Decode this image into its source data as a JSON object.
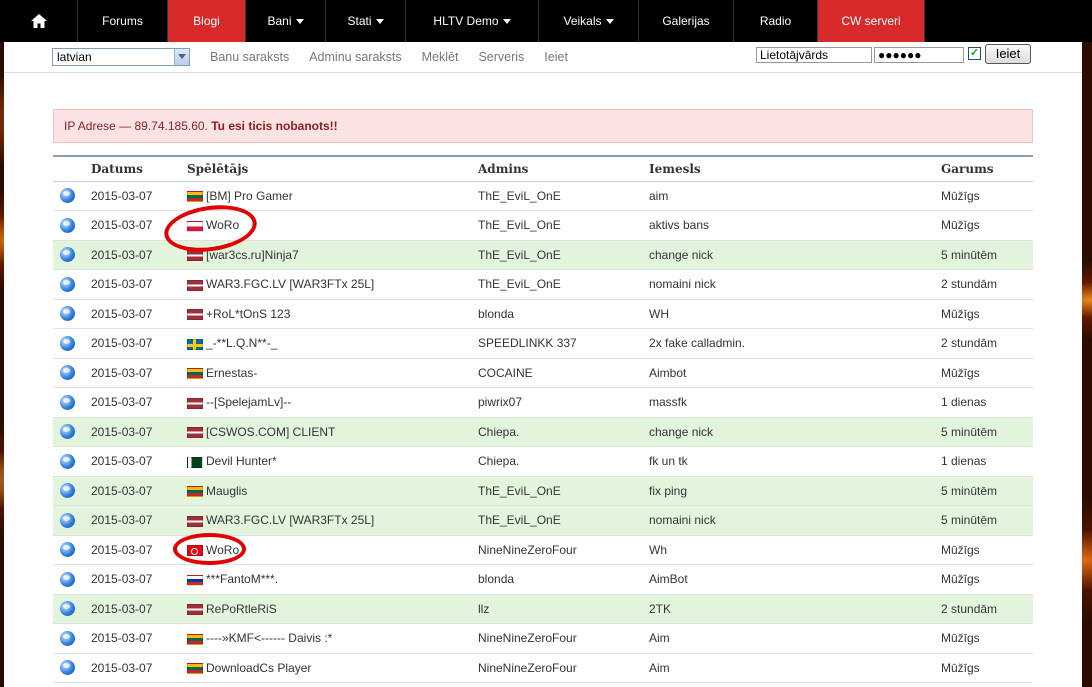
{
  "nav": {
    "items": [
      {
        "label": "Forums",
        "caret": false,
        "active": false
      },
      {
        "label": "Blogi",
        "caret": false,
        "active": true
      },
      {
        "label": "Bani",
        "caret": true,
        "active": false
      },
      {
        "label": "Stati",
        "caret": true,
        "active": false
      },
      {
        "label": "HLTV Demo",
        "caret": true,
        "active": false
      },
      {
        "label": "Veikals",
        "caret": true,
        "active": false
      },
      {
        "label": "Galerijas",
        "caret": false,
        "active": false
      },
      {
        "label": "Radio",
        "caret": false,
        "active": false
      },
      {
        "label": "CW serveri",
        "caret": false,
        "active": true
      }
    ]
  },
  "subbar": {
    "language": "latvian",
    "links": [
      "Banu saraksts",
      "Adminu saraksts",
      "Meklēt",
      "Serveris",
      "Ieiet"
    ],
    "username_value": "Lietotājvārds",
    "password_value": "●●●●●●",
    "login_label": "Ieiet"
  },
  "alert": {
    "prefix": "IP Adrese — 89.74.185.60. ",
    "message": "Tu esi ticis nobanots!!"
  },
  "table": {
    "headers": [
      "Datums",
      "Spēlētājs",
      "Admins",
      "Iemesls",
      "Garums"
    ],
    "rows": [
      {
        "date": "2015-03-07",
        "flag": "lt",
        "player": "[BM] Pro Gamer",
        "admin": "ThE_EviL_OnE",
        "reason": "aim",
        "length": "Mūžīgs",
        "green": false
      },
      {
        "date": "2015-03-07",
        "flag": "pl",
        "player": "WoRo",
        "admin": "ThE_EviL_OnE",
        "reason": "aktivs bans",
        "length": "Mūžīgs",
        "green": false
      },
      {
        "date": "2015-03-07",
        "flag": "lv",
        "player": "[war3cs.ru]Ninja7",
        "admin": "ThE_EviL_OnE",
        "reason": "change nick",
        "length": "5 minūtēm",
        "green": true
      },
      {
        "date": "2015-03-07",
        "flag": "lv",
        "player": "WAR3.FGC.LV [WAR3FTx 25L]",
        "admin": "ThE_EviL_OnE",
        "reason": "nomaini nick",
        "length": "2 stundām",
        "green": false
      },
      {
        "date": "2015-03-07",
        "flag": "lv",
        "player": "+RoL*tOnS 123",
        "admin": "blonda",
        "reason": "WH",
        "length": "Mūžīgs",
        "green": false
      },
      {
        "date": "2015-03-07",
        "flag": "se",
        "player": "_-**L.Q.N**-_",
        "admin": "SPEEDLINKK 337",
        "reason": "2x fake calladmin.",
        "length": "2 stundām",
        "green": false
      },
      {
        "date": "2015-03-07",
        "flag": "lt",
        "player": "Ernestas-",
        "admin": "COCAINE",
        "reason": "Aimbot",
        "length": "Mūžīgs",
        "green": false
      },
      {
        "date": "2015-03-07",
        "flag": "lv",
        "player": "--[SpelejamLv]--",
        "admin": "piwrix07",
        "reason": "massfk",
        "length": "1 dienas",
        "green": false
      },
      {
        "date": "2015-03-07",
        "flag": "lv",
        "player": "[CSWOS.COM] CLIENT",
        "admin": "Chiepa.",
        "reason": "change nick",
        "length": "5 minūtēm",
        "green": true
      },
      {
        "date": "2015-03-07",
        "flag": "pk",
        "player": "Devil Hunter*",
        "admin": "Chiepa.",
        "reason": "fk un tk",
        "length": "1 dienas",
        "green": false
      },
      {
        "date": "2015-03-07",
        "flag": "lt",
        "player": "Mauglis",
        "admin": "ThE_EviL_OnE",
        "reason": "fix ping",
        "length": "5 minūtēm",
        "green": true
      },
      {
        "date": "2015-03-07",
        "flag": "lv",
        "player": "WAR3.FGC.LV [WAR3FTx 25L]",
        "admin": "ThE_EviL_OnE",
        "reason": "nomaini nick",
        "length": "5 minūtēm",
        "green": true
      },
      {
        "date": "2015-03-07",
        "flag": "tr",
        "player": "WoRo",
        "admin": "NineNineZeroFour",
        "reason": "Wh",
        "length": "Mūžīgs",
        "green": false
      },
      {
        "date": "2015-03-07",
        "flag": "ru",
        "player": "***FantoM***.",
        "admin": "blonda",
        "reason": "AimBot",
        "length": "Mūžīgs",
        "green": false
      },
      {
        "date": "2015-03-07",
        "flag": "lv",
        "player": "RePoRtleRiS",
        "admin": "llz",
        "reason": "2TK",
        "length": "2 stundām",
        "green": true
      },
      {
        "date": "2015-03-07",
        "flag": "lt",
        "player": "----»KMF<------ Daivis :*",
        "admin": "NineNineZeroFour",
        "reason": "Aim",
        "length": "Mūžīgs",
        "green": false
      },
      {
        "date": "2015-03-07",
        "flag": "lt",
        "player": "DownloadCs Player",
        "admin": "NineNineZeroFour",
        "reason": "Aim",
        "length": "Mūžīgs",
        "green": false
      }
    ]
  }
}
